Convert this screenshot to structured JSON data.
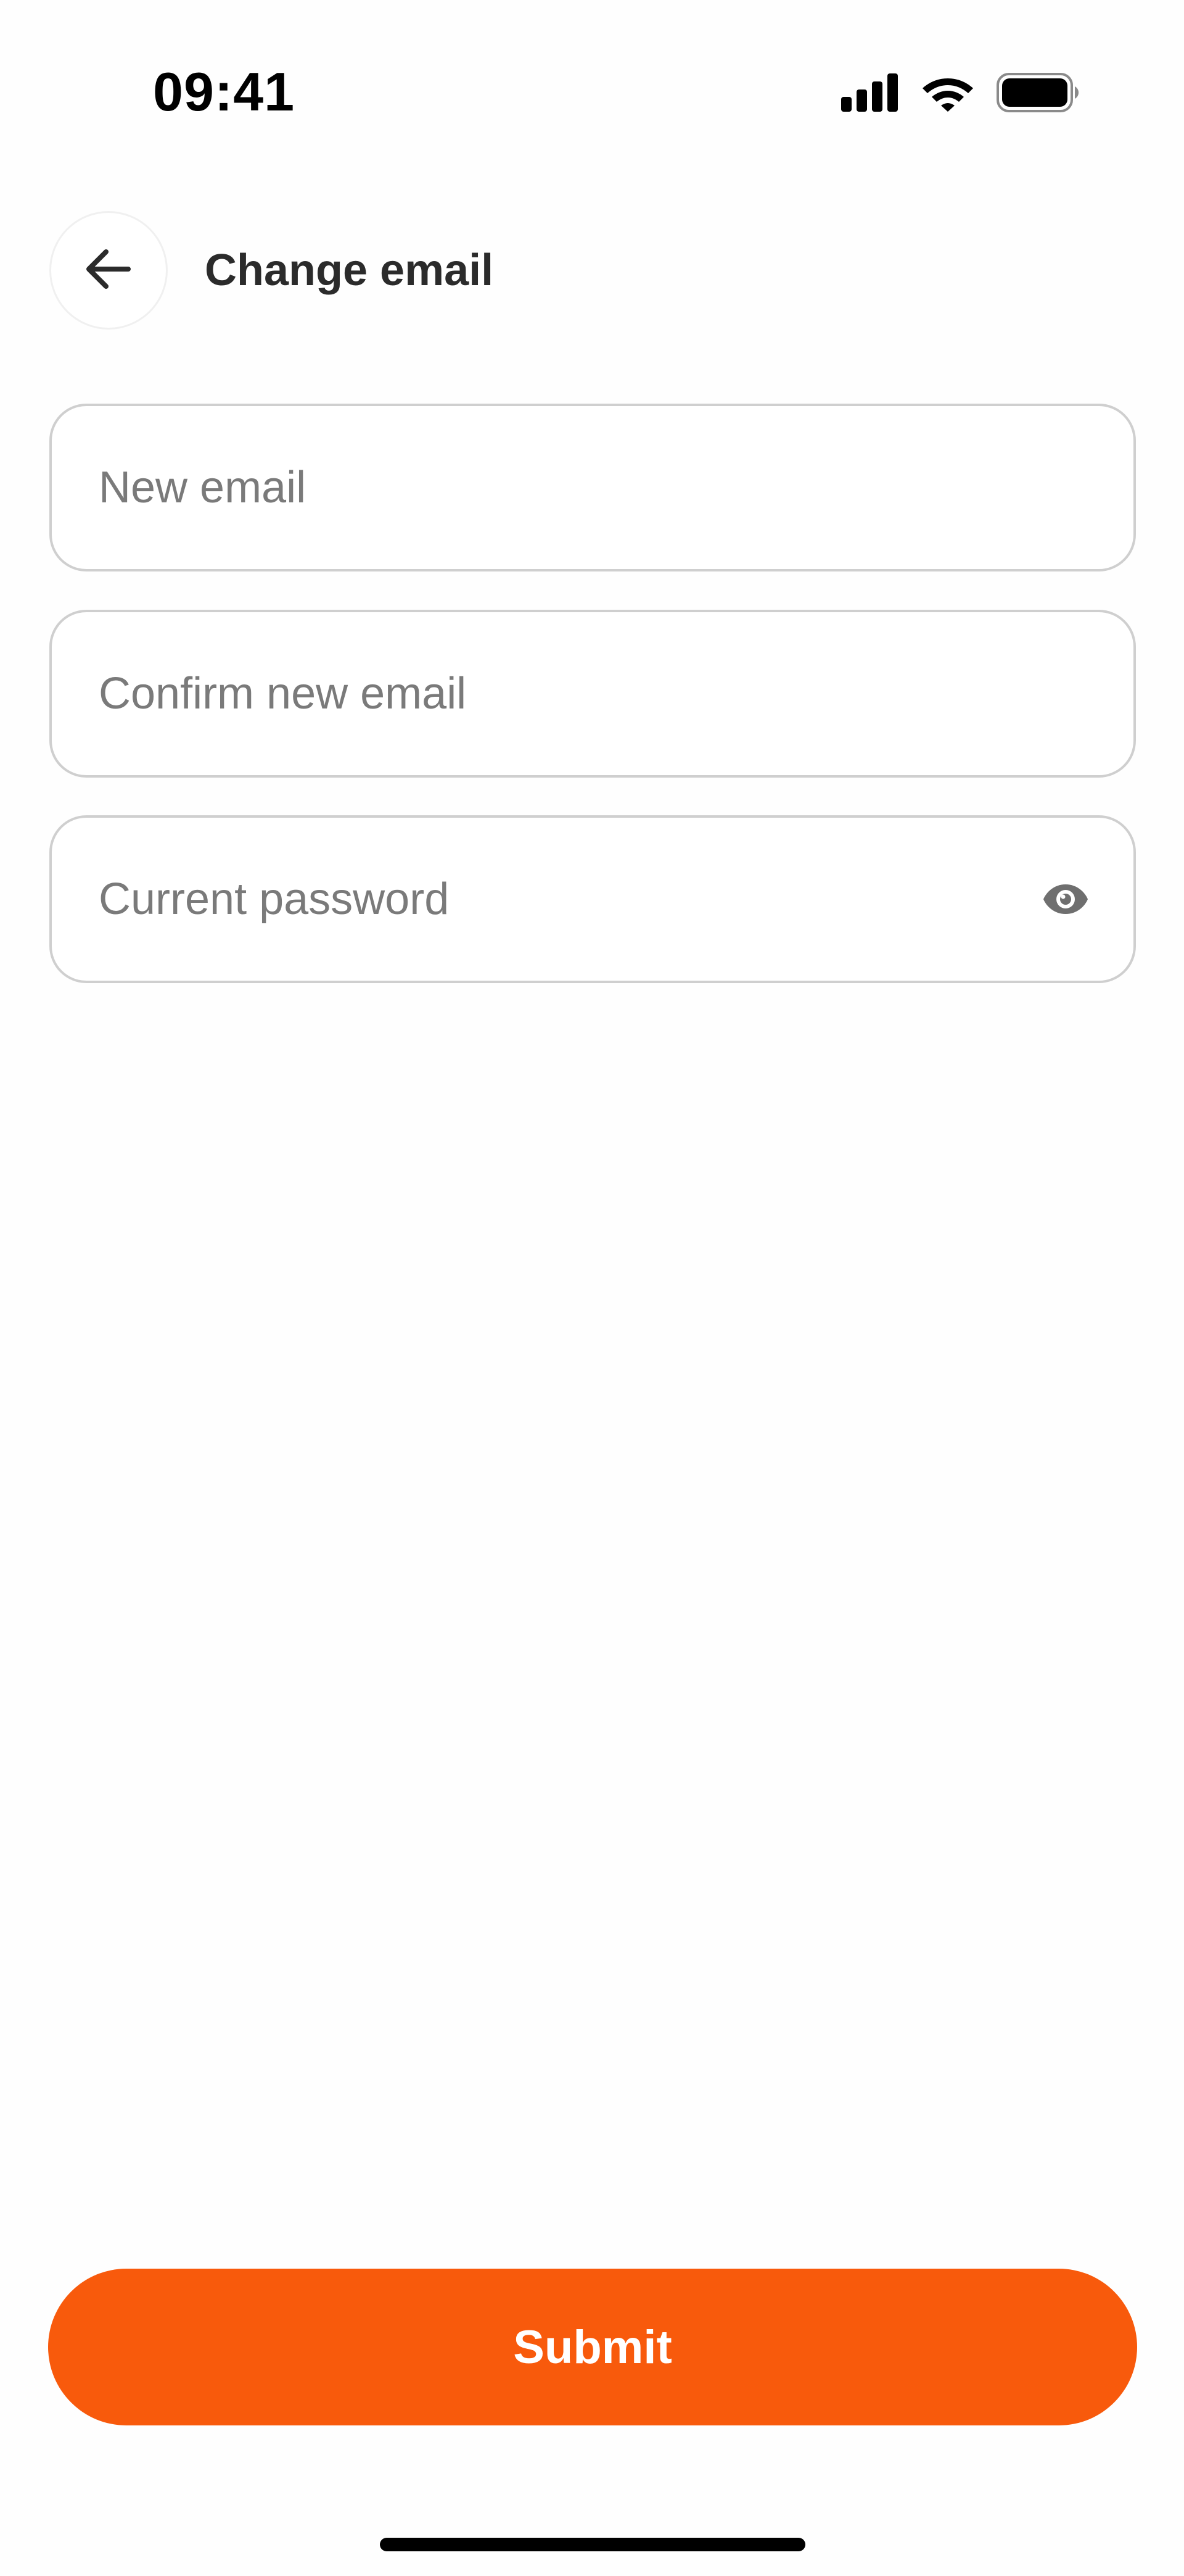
{
  "status_bar": {
    "time": "09:41",
    "icons": [
      "cellular-signal-icon",
      "wifi-icon",
      "battery-icon"
    ]
  },
  "header": {
    "back_icon": "arrow-left-icon",
    "title": "Change email"
  },
  "form": {
    "new_email": {
      "placeholder": "New email",
      "value": ""
    },
    "confirm_email": {
      "placeholder": "Confirm new email",
      "value": ""
    },
    "current_password": {
      "placeholder": "Current password",
      "value": "",
      "toggle_icon": "eye-icon"
    }
  },
  "submit": {
    "label": "Submit"
  },
  "colors": {
    "accent": "#f85a0c",
    "border": "#cfcfcf",
    "placeholder": "#7a7a7a",
    "title": "#2b2b2b"
  }
}
